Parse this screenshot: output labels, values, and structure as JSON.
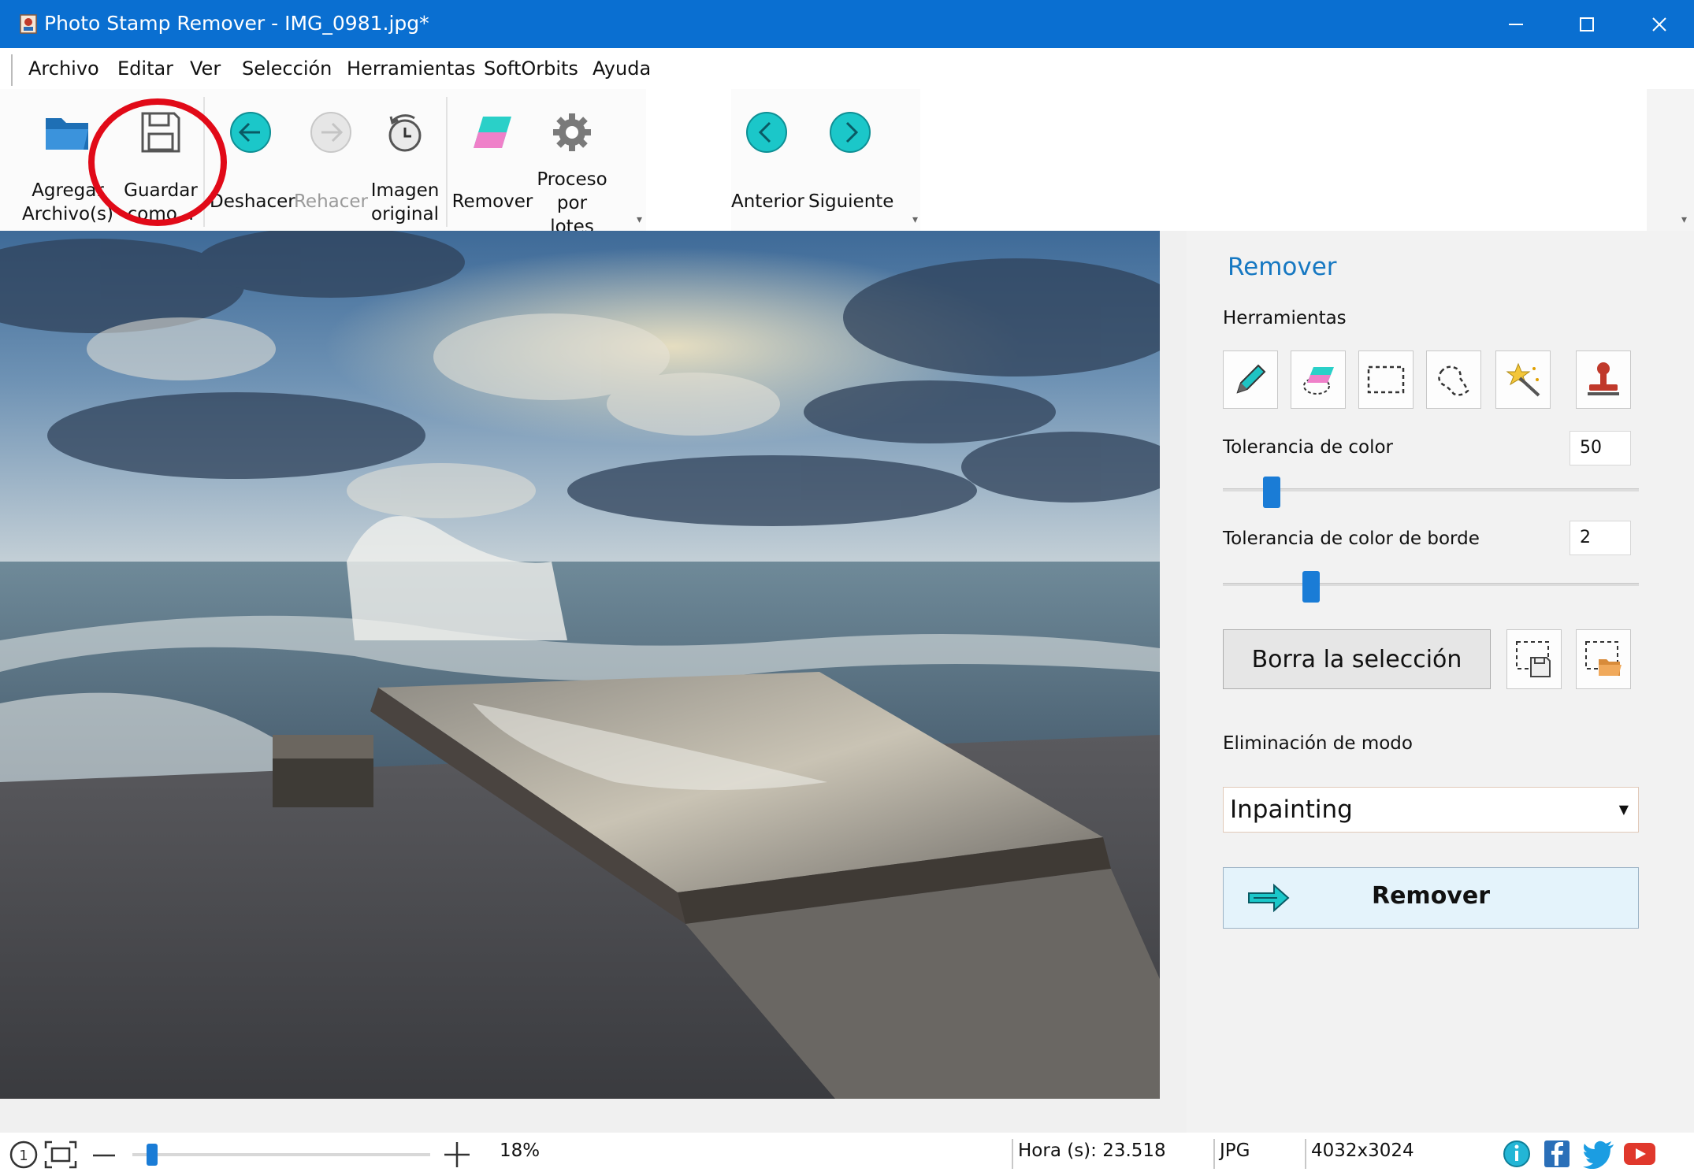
{
  "window": {
    "title": "Photo Stamp Remover - IMG_0981.jpg*",
    "accent": "#0a6fd1"
  },
  "menu": [
    "Archivo",
    "Editar",
    "Ver",
    "Selección",
    "Herramientas",
    "SoftOrbits",
    "Ayuda"
  ],
  "toolbar": {
    "add": "Agregar Archivo(s)",
    "save": "Guardar como...",
    "undo": "Deshacer",
    "redo": "Rehacer",
    "original": "Imagen original",
    "remove": "Remover",
    "batch": "Proceso por lotes",
    "prev": "Anterior",
    "next": "Siguiente"
  },
  "panel": {
    "title": "Remover",
    "tools_label": "Herramientas",
    "tools": [
      "pencil-icon",
      "eraser-icon",
      "rect-select-icon",
      "lasso-icon",
      "magic-wand-icon",
      "stamp-icon"
    ],
    "color_tolerance_label": "Tolerancia de color",
    "color_tolerance_value": "50",
    "color_tolerance_fraction": 0.1,
    "edge_tolerance_label": "Tolerancia de color de borde",
    "edge_tolerance_value": "2",
    "edge_tolerance_fraction": 0.2,
    "clear_selection": "Borra la selección",
    "mode_label": "Eliminación de modo",
    "mode_value": "Inpainting",
    "remove_button": "Remover"
  },
  "status": {
    "zoom": "18%",
    "zoom_fraction": 0.05,
    "time": "Hora (s): 23.518",
    "format": "JPG",
    "dimensions": "4032x3024"
  }
}
